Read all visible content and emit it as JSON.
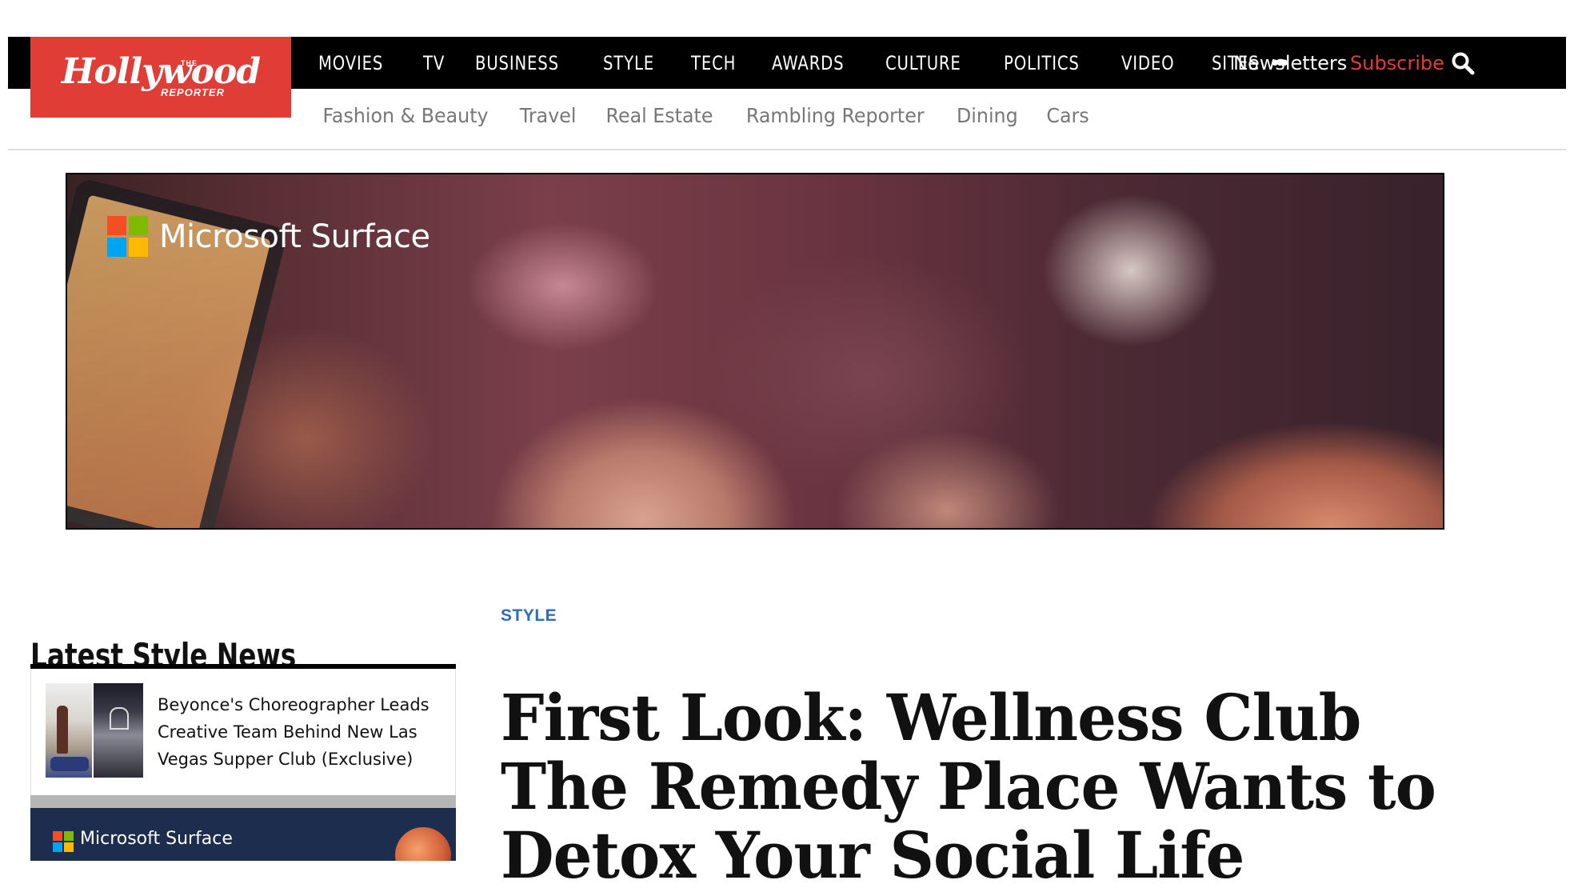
{
  "brand": {
    "logo_main": "Hollywood",
    "logo_the": "THE",
    "logo_sub": "REPORTER",
    "brand_color": "#e03d36"
  },
  "nav": {
    "items": [
      "MOVIES",
      "TV",
      "BUSINESS",
      "STYLE",
      "TECH",
      "AWARDS",
      "CULTURE",
      "POLITICS",
      "VIDEO",
      "SITES"
    ],
    "more_icon": "ellipsis-icon",
    "newsletters": "Newsletters",
    "subscribe": "Subscribe",
    "search_icon": "search-icon"
  },
  "subnav": {
    "items": [
      "Fashion & Beauty",
      "Travel",
      "Real Estate",
      "Rambling Reporter",
      "Dining",
      "Cars"
    ]
  },
  "ad": {
    "text": "Microsoft Surface",
    "logo_colors": [
      "#f25022",
      "#7fba00",
      "#00a4ef",
      "#ffb900"
    ]
  },
  "sidebar": {
    "title": "Latest Style News",
    "stories": [
      {
        "title": "Beyonce's Choreographer Leads Creative Team Behind New Las Vegas Supper Club (Exclusive)"
      }
    ],
    "ad_text": "Microsoft Surface"
  },
  "article": {
    "section": "STYLE",
    "section_color": "#2f6db5",
    "headline": "First Look: Wellness Club The Remedy Place Wants to Detox Your Social Life"
  }
}
